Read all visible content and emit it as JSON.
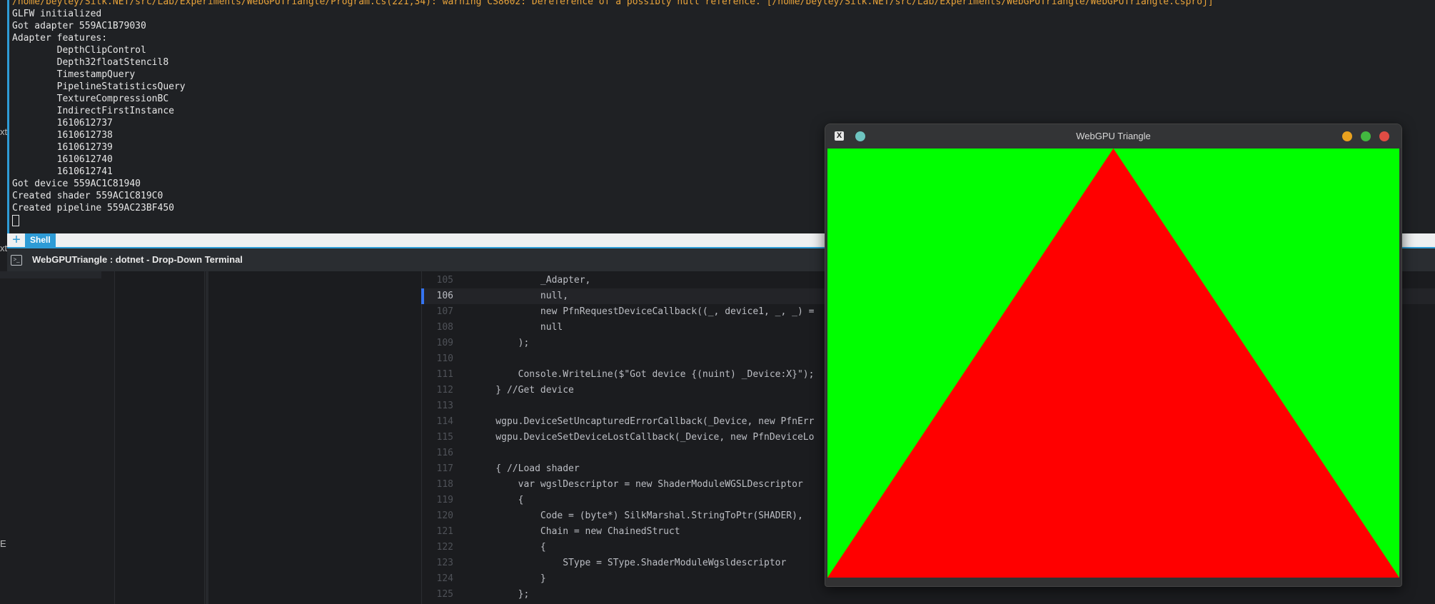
{
  "terminal": {
    "output_lines": [
      "/home/beyley/Silk.NET/src/Lab/Experiments/WebGPUTriangle/Program.cs(221,34): warning CS8602: Dereference of a possibly null reference. [/home/beyley/Silk.NET/src/Lab/Experiments/WebGPUTriangle/WebGPUTriangle.csproj]",
      "GLFW initialized",
      "Got adapter 559AC1B79030",
      "Adapter features:",
      "        DepthClipControl",
      "        Depth32floatStencil8",
      "        TimestampQuery",
      "        PipelineStatisticsQuery",
      "        TextureCompressionBC",
      "        IndirectFirstInstance",
      "        1610612737",
      "        1610612738",
      "        1610612739",
      "        1610612740",
      "        1610612741",
      "Got device 559AC1C81940",
      "Created shader 559AC1C819C0",
      "Created pipeline 559AC23BF450"
    ],
    "add_tab_glyph": "+",
    "tab_label": "Shell",
    "window_title": "WebGPUTriangle : dotnet - Drop-Down Terminal",
    "title_icon_glyph": ">_"
  },
  "editor": {
    "left_panel_fragments": [
      "xt",
      "xt",
      "E"
    ],
    "current_line": "106",
    "lines": [
      {
        "num": "105",
        "code": "            _Adapter,"
      },
      {
        "num": "106",
        "code": "            null,"
      },
      {
        "num": "107",
        "code": "            new PfnRequestDeviceCallback((_, device1, _, _) ="
      },
      {
        "num": "108",
        "code": "            null"
      },
      {
        "num": "109",
        "code": "        );"
      },
      {
        "num": "110",
        "code": ""
      },
      {
        "num": "111",
        "code": "        Console.WriteLine($\"Got device {(nuint) _Device:X}\");"
      },
      {
        "num": "112",
        "code": "    } //Get device"
      },
      {
        "num": "113",
        "code": ""
      },
      {
        "num": "114",
        "code": "    wgpu.DeviceSetUncapturedErrorCallback(_Device, new PfnErr"
      },
      {
        "num": "115",
        "code": "    wgpu.DeviceSetDeviceLostCallback(_Device, new PfnDeviceLo"
      },
      {
        "num": "116",
        "code": ""
      },
      {
        "num": "117",
        "code": "    { //Load shader"
      },
      {
        "num": "118",
        "code": "        var wgslDescriptor = new ShaderModuleWGSLDescriptor"
      },
      {
        "num": "119",
        "code": "        {"
      },
      {
        "num": "120",
        "code": "            Code = (byte*) SilkMarshal.StringToPtr(SHADER),"
      },
      {
        "num": "121",
        "code": "            Chain = new ChainedStruct"
      },
      {
        "num": "122",
        "code": "            {"
      },
      {
        "num": "123",
        "code": "                SType = SType.ShaderModuleWgsldescriptor"
      },
      {
        "num": "124",
        "code": "            }"
      },
      {
        "num": "125",
        "code": "        };"
      }
    ]
  },
  "gpu_window": {
    "title": "WebGPU Triangle",
    "app_icon_glyph": "X",
    "clear_color": "#00ff00",
    "triangle_color": "#ff0000"
  }
}
